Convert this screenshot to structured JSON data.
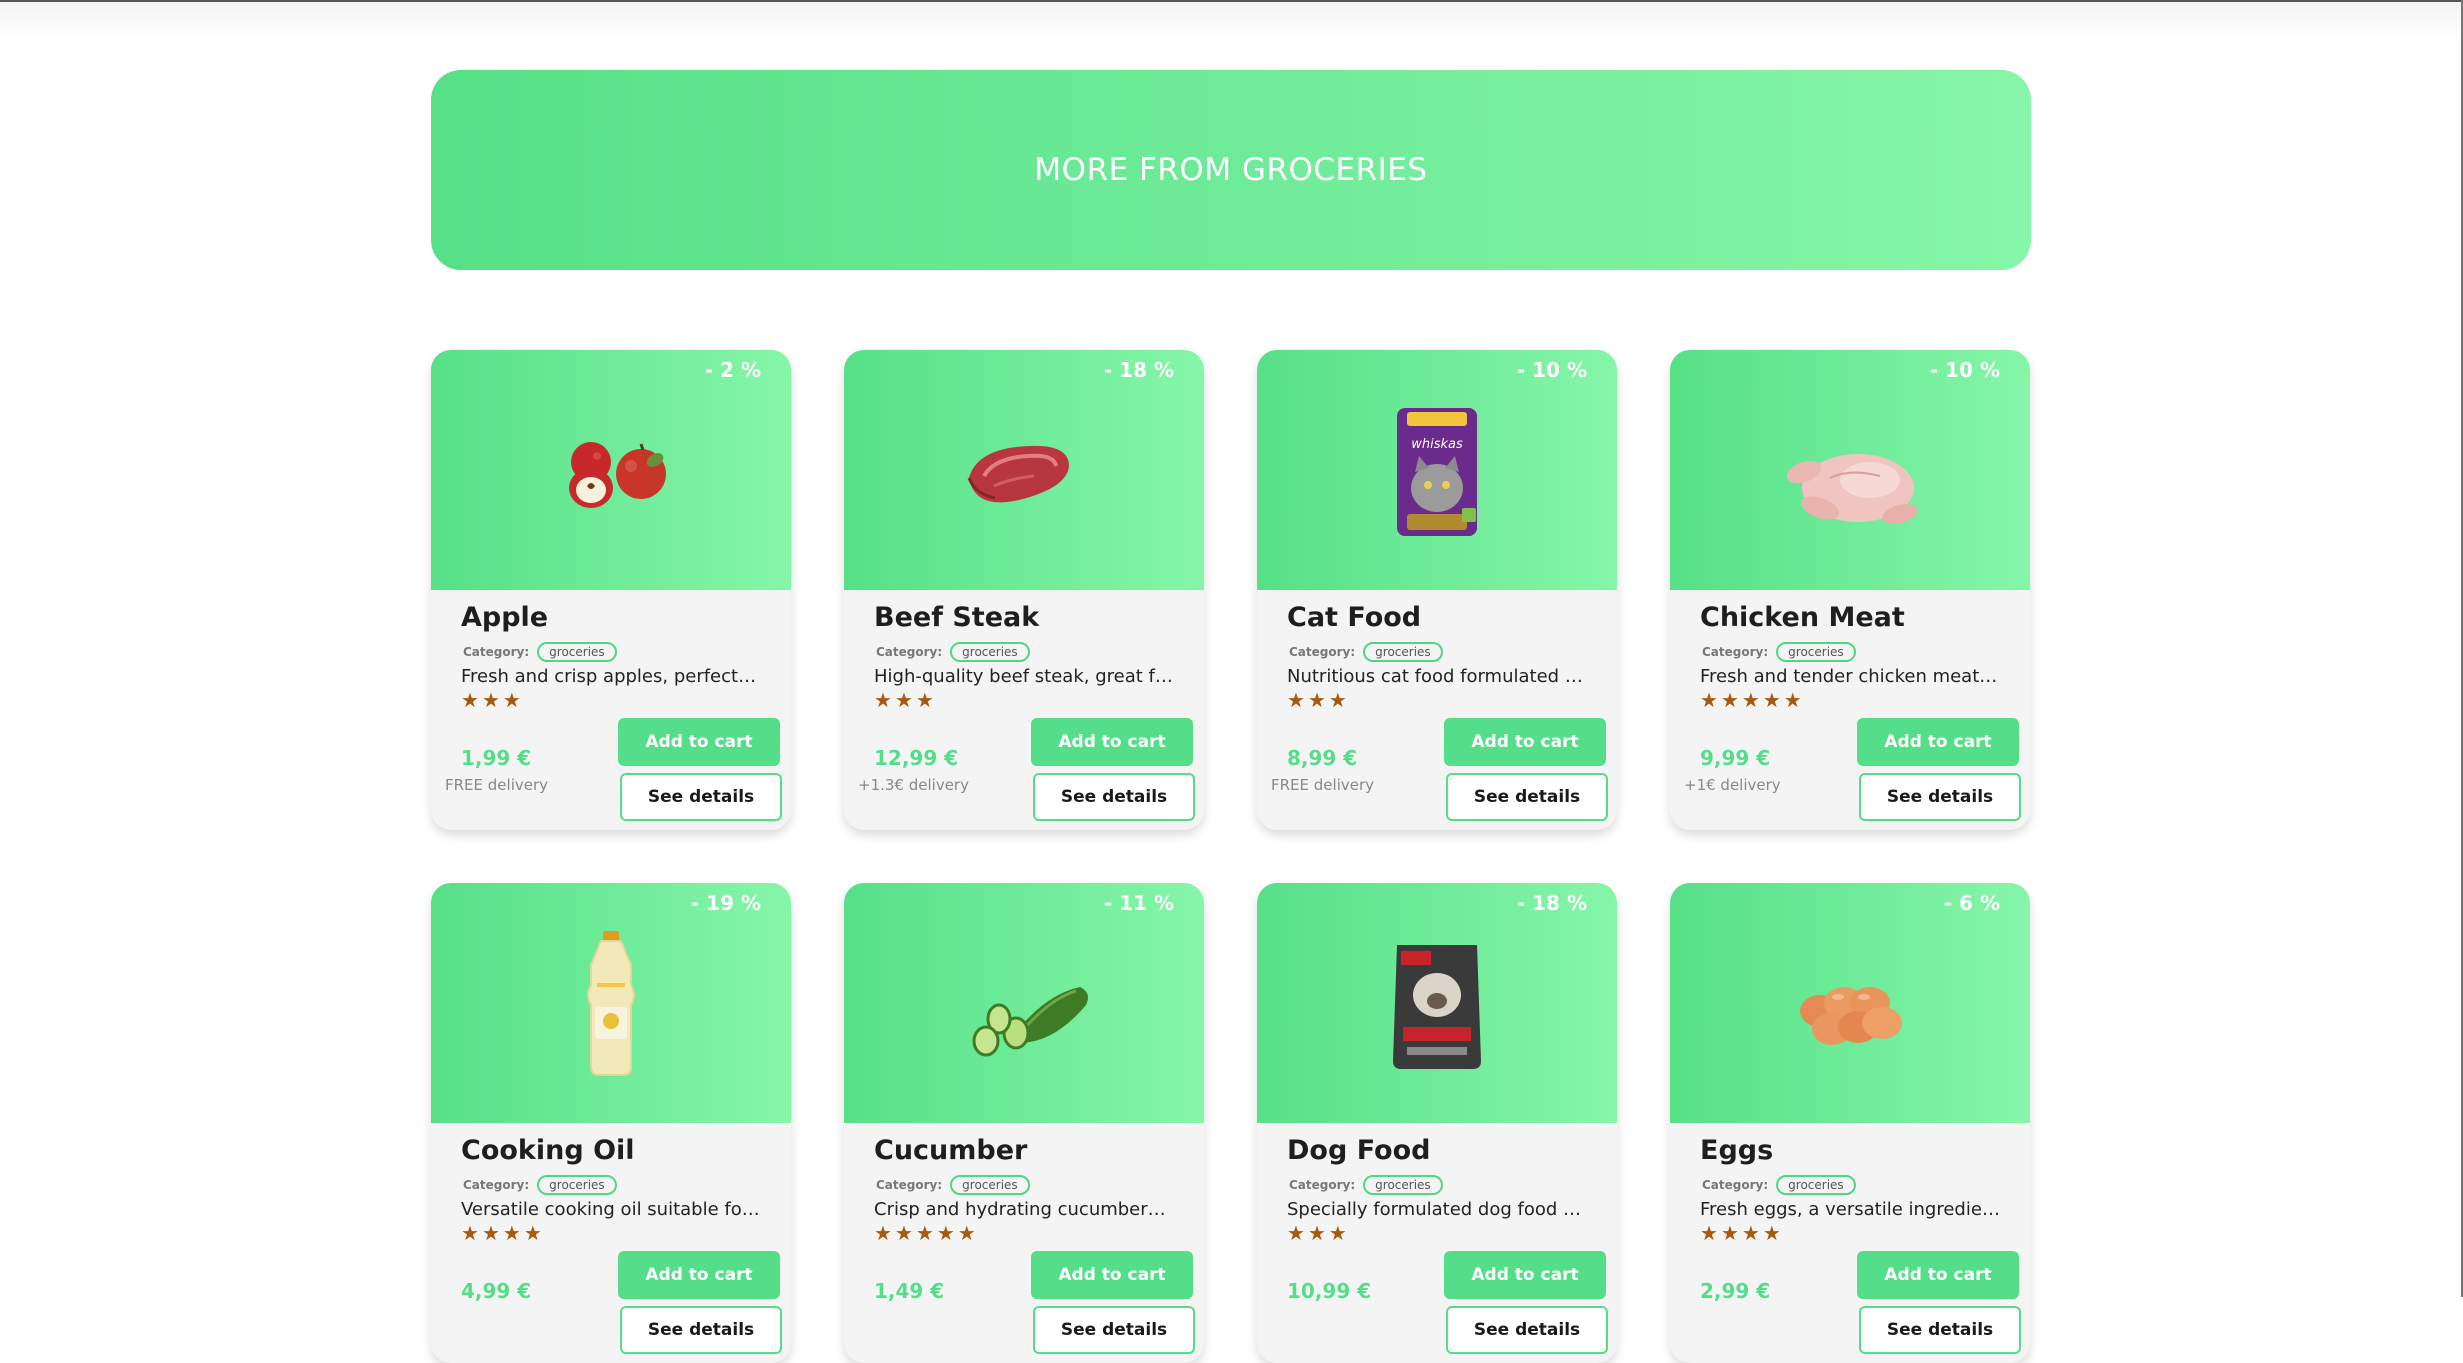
{
  "banner": {
    "title": "MORE FROM GROCERIES"
  },
  "colors": {
    "accent": "#55de89",
    "gradient_start": "#56e088",
    "gradient_end": "#86f6a9",
    "star": "#a65a10"
  },
  "category_label": "Category:",
  "buttons": {
    "add_to_cart": "Add to cart",
    "see_details": "See details"
  },
  "products": [
    {
      "discount": "- 2 %",
      "image_icon": "apple-icon",
      "name": "Apple",
      "category": "groceries",
      "description": "Fresh and crisp apples, perfect f...",
      "rating": 3,
      "price": "1,99 €",
      "delivery": "FREE delivery"
    },
    {
      "discount": "- 18 %",
      "image_icon": "beef-steak-icon",
      "name": "Beef Steak",
      "category": "groceries",
      "description": "High-quality beef steak, great for...",
      "rating": 3,
      "price": "12,99 €",
      "delivery": "+1.3€ delivery"
    },
    {
      "discount": "- 10 %",
      "image_icon": "cat-food-pouch-icon",
      "name": "Cat Food",
      "category": "groceries",
      "description": "Nutritious cat food formulated to...",
      "rating": 3,
      "price": "8,99 €",
      "delivery": "FREE delivery"
    },
    {
      "discount": "- 10 %",
      "image_icon": "chicken-meat-icon",
      "name": "Chicken Meat",
      "category": "groceries",
      "description": "Fresh and tender chicken meat, ...",
      "rating": 5,
      "price": "9,99 €",
      "delivery": "+1€ delivery"
    },
    {
      "discount": "- 19 %",
      "image_icon": "cooking-oil-bottle-icon",
      "name": "Cooking Oil",
      "category": "groceries",
      "description": "Versatile cooking oil suitable for f...",
      "rating": 4,
      "price": "4,99 €",
      "delivery": ""
    },
    {
      "discount": "- 11 %",
      "image_icon": "cucumber-icon",
      "name": "Cucumber",
      "category": "groceries",
      "description": "Crisp and hydrating cucumbers, ...",
      "rating": 5,
      "price": "1,49 €",
      "delivery": ""
    },
    {
      "discount": "- 18 %",
      "image_icon": "dog-food-bag-icon",
      "name": "Dog Food",
      "category": "groceries",
      "description": "Specially formulated dog food d...",
      "rating": 3,
      "price": "10,99 €",
      "delivery": ""
    },
    {
      "discount": "- 6 %",
      "image_icon": "eggs-icon",
      "name": "Eggs",
      "category": "groceries",
      "description": "Fresh eggs, a versatile ingredient...",
      "rating": 4,
      "price": "2,99 €",
      "delivery": ""
    }
  ]
}
